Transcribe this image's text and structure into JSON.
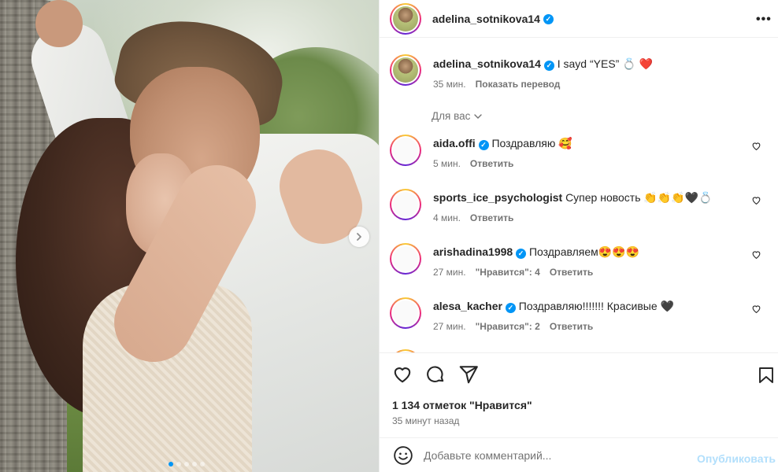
{
  "post": {
    "author": "adelina_sotnikova14",
    "menu_icon": "more-horizontal-icon",
    "image_dots_total": 5,
    "image_dots_active": 1
  },
  "caption": {
    "username": "adelina_sotnikova14",
    "text": "I sayd “YES” 💍 ❤️",
    "time": "35 мин.",
    "translate": "Показать перевод"
  },
  "for_you": "Для вас",
  "comments": [
    {
      "username": "aida.offi",
      "verified": true,
      "text": "Поздравляю 🥰",
      "time": "5 мин.",
      "likes": "",
      "reply": "Ответить"
    },
    {
      "username": "sports_ice_psychologist",
      "verified": false,
      "text": "Супер новость 👏👏👏🖤💍",
      "time": "4 мин.",
      "likes": "",
      "reply": "Ответить"
    },
    {
      "username": "arishadina1998",
      "verified": true,
      "text": "Поздравляем😍😍😍",
      "time": "27 мин.",
      "likes": "\"Нравится\": 4",
      "reply": "Ответить"
    },
    {
      "username": "alesa_kacher",
      "verified": true,
      "text": "Поздравляю!!!!!!! Красивые 🖤",
      "time": "27 мин.",
      "likes": "\"Нравится\": 2",
      "reply": "Ответить"
    }
  ],
  "actions": {
    "likes_text": "1 134 отметок \"Нравится\"",
    "posted_ago": "35 минут назад"
  },
  "add_comment": {
    "placeholder": "Добавьте комментарий...",
    "post_label": "Опубликовать"
  },
  "colors": {
    "accent": "#0095f6",
    "post_disabled": "#b2dffc",
    "muted": "#737373"
  }
}
